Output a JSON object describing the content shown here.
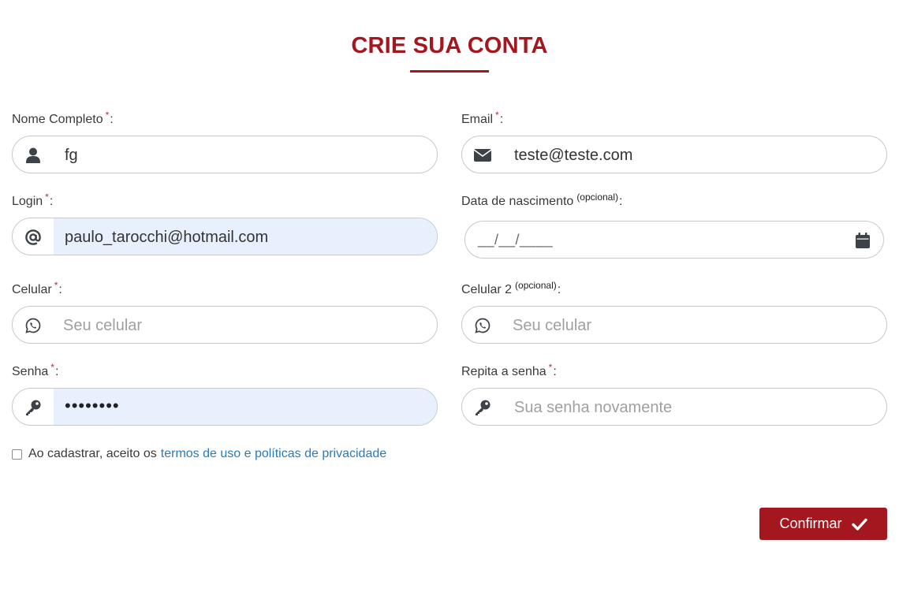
{
  "page": {
    "title": "CRIE SUA CONTA"
  },
  "form": {
    "required_mark": "*",
    "colon": ":",
    "optional_mark": "(opcional)",
    "nome": {
      "label": "Nome Completo",
      "value": "fg",
      "icon": "user-icon"
    },
    "email": {
      "label": "Email",
      "value": "teste@teste.com",
      "icon": "envelope-icon"
    },
    "login": {
      "label": "Login",
      "value": "paulo_tarocchi@hotmail.com",
      "icon": "at-icon"
    },
    "nascimento": {
      "label": "Data de nascimento",
      "mask": "__/__/____",
      "icon": "calendar-icon"
    },
    "celular": {
      "label": "Celular",
      "placeholder": "Seu celular",
      "icon": "whatsapp-icon"
    },
    "celular2": {
      "label": "Celular 2",
      "placeholder": "Seu celular",
      "icon": "whatsapp-icon"
    },
    "senha": {
      "label": "Senha",
      "value": "••••••••",
      "icon": "key-icon"
    },
    "repita": {
      "label": "Repita a senha",
      "placeholder": "Sua senha novamente",
      "icon": "key-icon"
    },
    "terms_text": "Ao cadastrar, aceito os",
    "terms_link": "termos de uso e políticas de privacidade",
    "terms_checked": false
  },
  "actions": {
    "confirm_label": "Confirmar"
  },
  "colors": {
    "accent": "#a5171f",
    "link": "#2a7ab8",
    "autofill": "#e8f0fe"
  }
}
